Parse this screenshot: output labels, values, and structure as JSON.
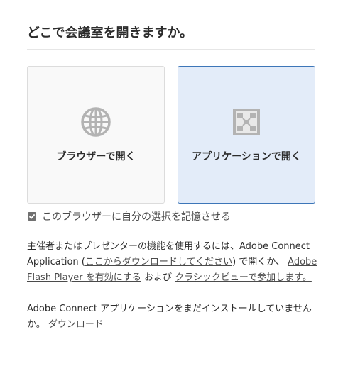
{
  "page_title": "どこで会議室を開きますか。",
  "options": {
    "browser": {
      "label": "ブラウザーで開く",
      "icon": "globe-icon"
    },
    "application": {
      "label": "アプリケーションで開く",
      "icon": "adobe-connect-app-icon",
      "selected": true
    }
  },
  "remember": {
    "checked": true,
    "label": "このブラウザーに自分の選択を記憶させる"
  },
  "host_note": {
    "text_before": "主催者またはプレゼンターの機能を使用するには、Adobe Connect Application (",
    "link_download_here": "ここからダウンロードしてください",
    "text_after_link1": ") で開くか、 ",
    "link_enable_flash": "Adobe Flash Player を有効にする",
    "text_and": " および ",
    "link_classic_view": "クラシックビューで参加します。"
  },
  "install_note": {
    "text": "Adobe Connect アプリケーションをまだインストールしていませんか。 ",
    "link_download": "ダウンロード"
  },
  "colors": {
    "selected_bg": "#e3ecf9",
    "selected_border": "#3d76b8",
    "card_bg": "#f9f9f9",
    "icon_gray": "#b3b3b3"
  }
}
